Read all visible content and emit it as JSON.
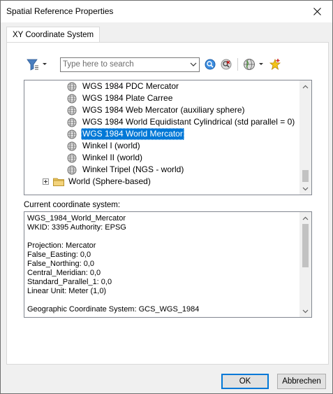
{
  "window": {
    "title": "Spatial Reference Properties"
  },
  "tabs": [
    {
      "label": "XY Coordinate System",
      "active": true
    }
  ],
  "toolbar": {
    "filter_icon": "filter-icon",
    "search_placeholder": "Type here to search",
    "search_value": "",
    "search_button_icon": "search-go-icon",
    "clear_search_icon": "clear-search-icon",
    "globe_menu_icon": "globe-icon",
    "add_favorite_icon": "add-favorite-icon"
  },
  "tree": {
    "items": [
      {
        "label": "WGS 1984 PDC Mercator",
        "icon": "globe-icon",
        "selected": false
      },
      {
        "label": "WGS 1984 Plate Carree",
        "icon": "globe-icon",
        "selected": false
      },
      {
        "label": "WGS 1984 Web Mercator (auxiliary sphere)",
        "icon": "globe-icon",
        "selected": false
      },
      {
        "label": "WGS 1984 World Equidistant Cylindrical (std parallel = 0)",
        "icon": "globe-icon",
        "selected": false
      },
      {
        "label": "WGS 1984 World Mercator",
        "icon": "globe-icon",
        "selected": true
      },
      {
        "label": "Winkel I (world)",
        "icon": "globe-icon",
        "selected": false
      },
      {
        "label": "Winkel II (world)",
        "icon": "globe-icon",
        "selected": false
      },
      {
        "label": "Winkel Tripel (NGS - world)",
        "icon": "globe-icon",
        "selected": false
      }
    ],
    "folder": {
      "label": "World (Sphere-based)",
      "expand_glyph": "+",
      "icon": "folder-icon"
    }
  },
  "current_cs": {
    "label": "Current coordinate system:",
    "lines": [
      "WGS_1984_World_Mercator",
      "WKID: 3395 Authority: EPSG",
      "",
      "Projection: Mercator",
      "False_Easting: 0,0",
      "False_Northing: 0,0",
      "Central_Meridian: 0,0",
      "Standard_Parallel_1: 0,0",
      "Linear Unit: Meter (1,0)",
      "",
      "Geographic Coordinate System: GCS_WGS_1984"
    ]
  },
  "buttons": {
    "ok": "OK",
    "cancel": "Abbrechen"
  },
  "colors": {
    "selection": "#0078d7",
    "folder": "#e8c15a"
  }
}
